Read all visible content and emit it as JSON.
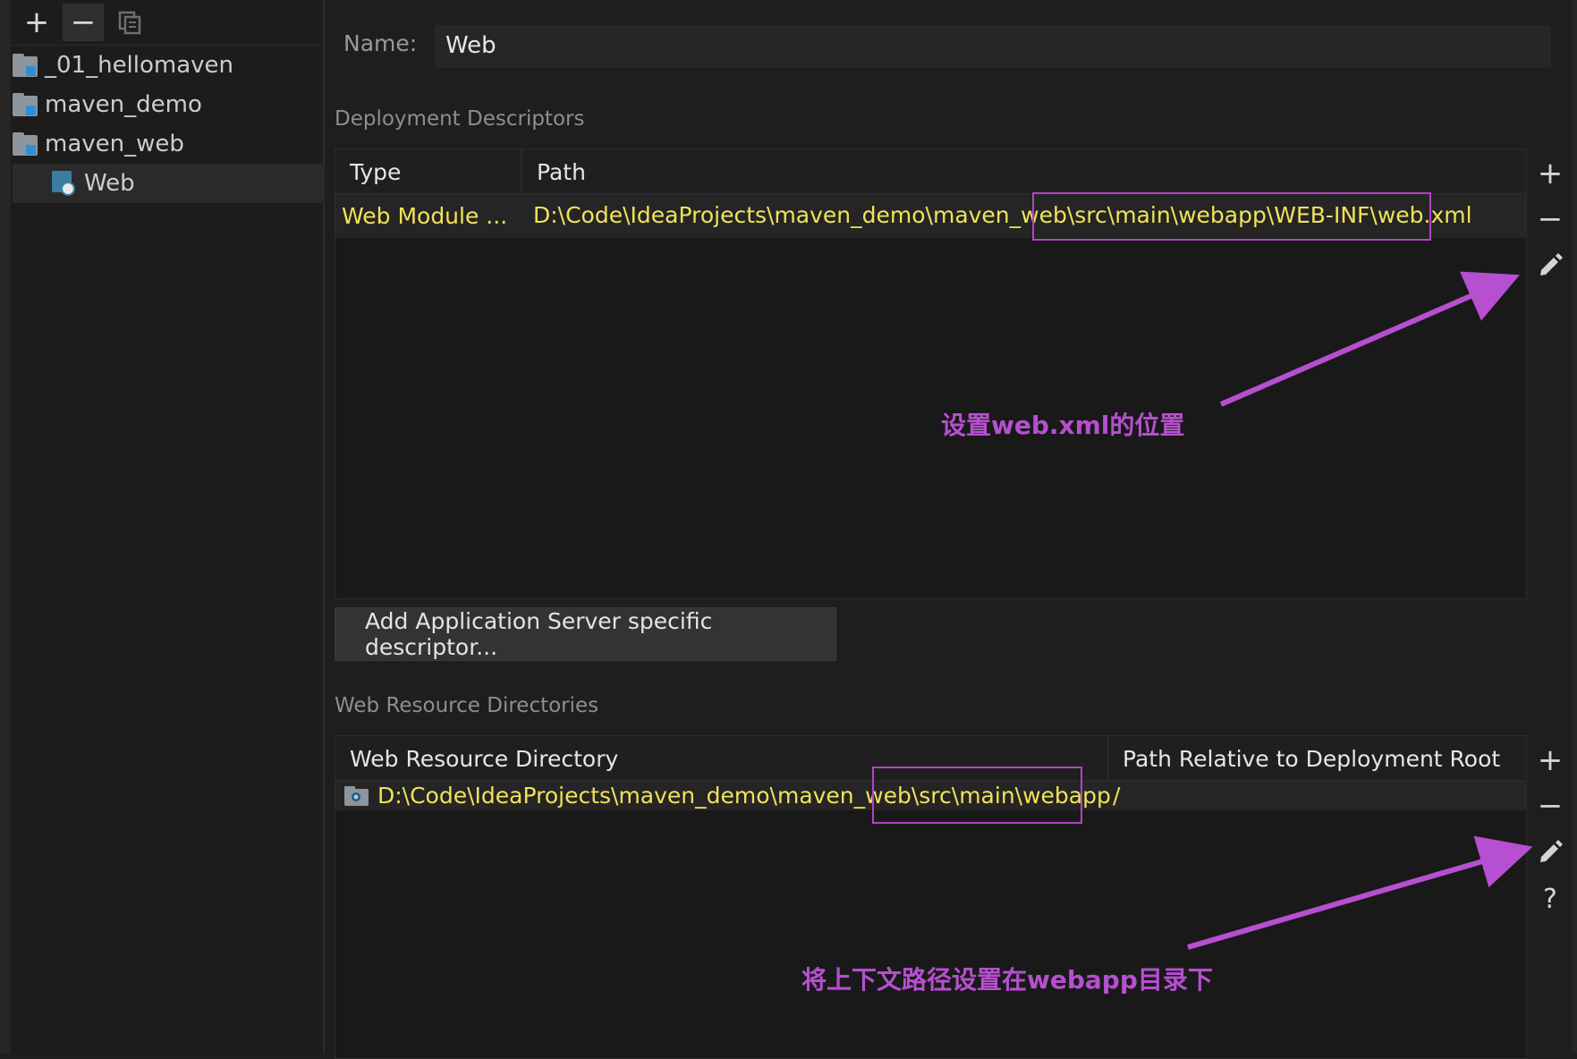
{
  "tree": {
    "toolbar": {
      "add": "+",
      "remove": "−"
    },
    "items": [
      {
        "label": "_01_hellomaven"
      },
      {
        "label": "maven_demo"
      },
      {
        "label": "maven_web"
      },
      {
        "label": "Web"
      }
    ]
  },
  "facet": {
    "name_label": "Name:",
    "name_value": "Web"
  },
  "deployment_descriptors": {
    "section_label": "Deployment Descriptors",
    "columns": [
      "Type",
      "Path"
    ],
    "rows": [
      {
        "type": "Web Module ...",
        "path": "D:\\Code\\IdeaProjects\\maven_demo\\maven_web\\src\\main\\webapp\\WEB-INF\\web.xml"
      }
    ],
    "add_server_button": "Add Application Server specific descriptor..."
  },
  "web_resources": {
    "section_label": "Web Resource Directories",
    "columns": [
      "Web Resource Directory",
      "Path Relative to Deployment Root"
    ],
    "rows": [
      {
        "directory": "D:\\Code\\IdeaProjects\\maven_demo\\maven_web\\src\\main\\webapp",
        "relative": "/"
      }
    ]
  },
  "side_buttons": {
    "add": "+",
    "remove": "−",
    "help": "?"
  },
  "annotations": {
    "descriptor_note": "设置web.xml的位置",
    "resource_note": "将上下文路径设置在webapp目录下"
  },
  "colors": {
    "accent_path": "#f1e25a",
    "annotation": "#b64fd0",
    "folder_marker": "#2f8fd6"
  },
  "icons": [
    "plus-icon",
    "minus-icon",
    "copy-icon",
    "folder-icon",
    "web-module-icon",
    "pencil-icon",
    "help-icon"
  ]
}
